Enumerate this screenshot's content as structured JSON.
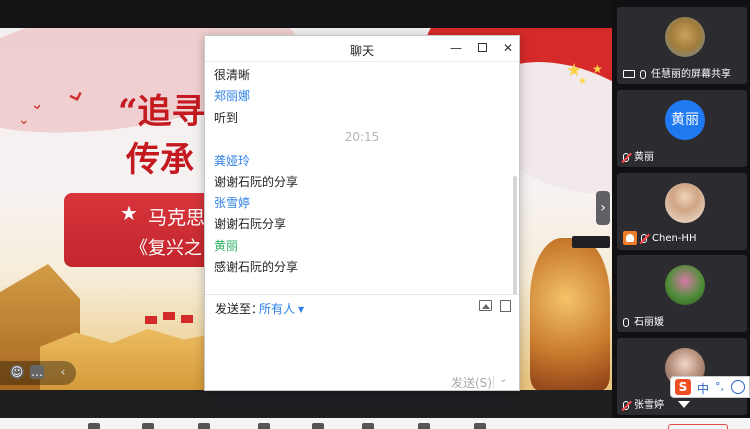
{
  "chat": {
    "title": "聊天",
    "messages": [
      {
        "kind": "text",
        "text": "很清晰"
      },
      {
        "kind": "sender",
        "text": "郑丽娜"
      },
      {
        "kind": "text",
        "text": "听到"
      },
      {
        "kind": "time",
        "text": "20:15"
      },
      {
        "kind": "sender",
        "text": "龚娅玲"
      },
      {
        "kind": "text",
        "text": "谢谢石阮的分享"
      },
      {
        "kind": "sender",
        "text": "张雪婷"
      },
      {
        "kind": "text",
        "text": "谢谢石阮分享"
      },
      {
        "kind": "sender-green",
        "text": "黄丽"
      },
      {
        "kind": "text",
        "text": "感谢石阮的分享"
      }
    ],
    "send_to_label": "发送至：",
    "recipient": "所有人",
    "send_button": "发送(S)"
  },
  "slide": {
    "title_line1": "“追寻",
    "title_line2": "传承",
    "banner_star": "★",
    "banner_line1": "马克思",
    "banner_line2": "《复兴之"
  },
  "participants": [
    {
      "name": "任慧丽的屏幕共享",
      "status": "screen-share",
      "avatar_text": ""
    },
    {
      "name": "黄丽",
      "status": "muted",
      "avatar_text": "黄丽"
    },
    {
      "name": "Chen-HH",
      "status": "muted-camera",
      "avatar_text": ""
    },
    {
      "name": "石丽媛",
      "status": "mic",
      "avatar_text": ""
    },
    {
      "name": "张雪婷",
      "status": "muted",
      "avatar_text": ""
    }
  ],
  "ime": {
    "logo": "S",
    "lang": "中",
    "punct": "°,"
  },
  "colors": {
    "accent_blue": "#2e82e6",
    "sender_green": "#2ab063",
    "avatar_blue": "#1f7af2",
    "slide_red": "#c4191f"
  }
}
